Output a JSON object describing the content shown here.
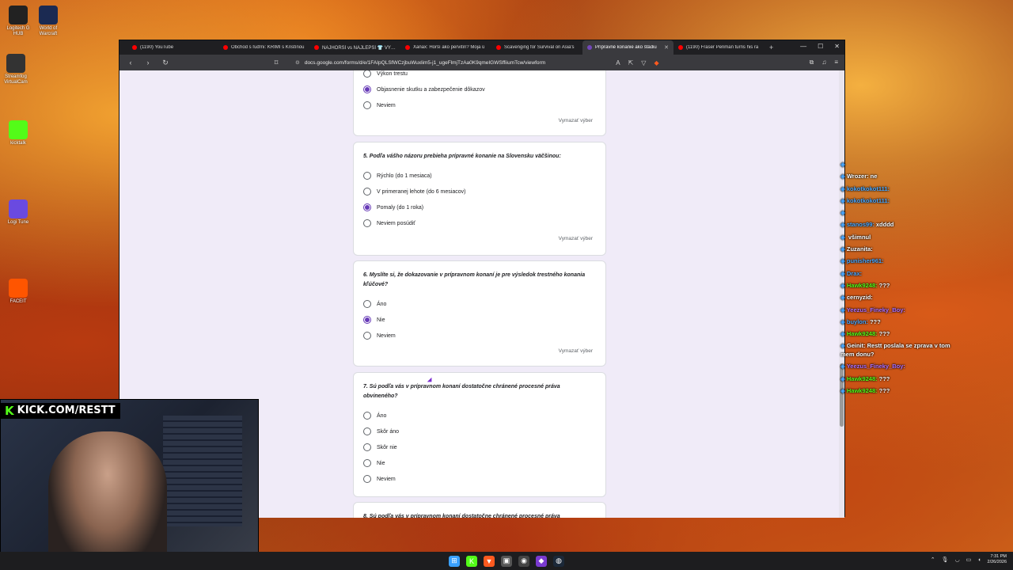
{
  "desktop_icons": [
    {
      "name": "logitech-ghub-icon",
      "label": "Logitech G HUB",
      "color": "#222"
    },
    {
      "name": "world-of-warcraft-icon",
      "label": "World of Warcraft",
      "color": "#1b2a52"
    },
    {
      "name": "streamfog-icon",
      "label": "Streamfog VirtualCam",
      "color": "#333"
    },
    {
      "name": "kicktalk-icon",
      "label": "kicktalk",
      "color": "#53fc18"
    },
    {
      "name": "logi-tune-icon",
      "label": "Logi Tune",
      "color": "#6a4ae0"
    },
    {
      "name": "faceit-icon",
      "label": "FACEIT",
      "color": "#ff5500"
    }
  ],
  "browser": {
    "tabs": [
      {
        "title": "(1190) YouTube",
        "color": "#ff0000",
        "active": false
      },
      {
        "title": "Obchod s ľuďmi: KRIMI s Kristínou",
        "color": "#ff0000",
        "active": false
      },
      {
        "title": "NAJHORŠÍ vs NAJLEPŠÍ 👕 VÝPRA",
        "color": "#ff0000",
        "active": false
      },
      {
        "title": "Xanax: Horší ako pervitín? Moja ú",
        "color": "#ff0000",
        "active": false
      },
      {
        "title": "Scavenging for Survival on Asia's ",
        "color": "#ff0000",
        "active": false
      },
      {
        "title": "Prípravné konanie ako štádiu",
        "color": "#7248b9",
        "active": true
      },
      {
        "title": "(1190) Fraser Penman turns his ra",
        "color": "#ff0000",
        "active": false
      }
    ],
    "new_tab": "+",
    "url": "docs.google.com/forms/d/e/1FAIpQLSfWCzjbuWuxlim5-j1_ugeFlmjTzAa0K9qmeIGWSffiiumTcw/viewform"
  },
  "form": {
    "clear_label": "Vymazať výber",
    "q4_partial": {
      "options": [
        {
          "label": "Výkon trestu",
          "selected": false
        },
        {
          "label": "Objasnenie skutku a zabezpečenie dôkazov",
          "selected": true
        },
        {
          "label": "Neviem",
          "selected": false
        }
      ]
    },
    "q5": {
      "title": "5. Podľa vášho názoru prebieha prípravné konanie na Slovensku väčšinou:",
      "options": [
        {
          "label": "Rýchlo (do 1 mesiaca)",
          "selected": false
        },
        {
          "label": "V primeranej lehote (do 6 mesiacov)",
          "selected": false
        },
        {
          "label": "Pomaly (do 1 roka)",
          "selected": true
        },
        {
          "label": "Neviem posúdiť",
          "selected": false
        }
      ]
    },
    "q6": {
      "title": "6. Myslíte si, že dokazovanie v prípravnom konaní je pre výsledok trestného konania kľúčové?",
      "options": [
        {
          "label": "Áno",
          "selected": false
        },
        {
          "label": "Nie",
          "selected": true
        },
        {
          "label": "Neviem",
          "selected": false
        }
      ]
    },
    "q7": {
      "title": "7. Sú podľa vás v prípravnom konaní dostatočne chránené procesné práva obvineného?",
      "options": [
        {
          "label": "Áno",
          "selected": false
        },
        {
          "label": "Skôr áno",
          "selected": false
        },
        {
          "label": "Skôr nie",
          "selected": false
        },
        {
          "label": "Nie",
          "selected": false
        },
        {
          "label": "Neviem",
          "selected": false
        }
      ]
    },
    "q8_partial_title": "8. Sú podľa vás v prípravnom konaní dostatočne chránené procesné práva"
  },
  "chat": [
    {
      "name": "",
      "text": "",
      "color": "#4aa8ff"
    },
    {
      "name": "Wrozer:",
      "text": "ne",
      "color": "#ffffff"
    },
    {
      "name": "kokotkokot111:",
      "text": "",
      "color": "#4aa8ff"
    },
    {
      "name": "kokotkokot111:",
      "text": "",
      "color": "#4aa8ff"
    },
    {
      "name": "",
      "text": "",
      "color": "#4aa8ff"
    },
    {
      "name": "stanos99:",
      "text": "xdddd",
      "color": "#4aa8ff"
    },
    {
      "name": "",
      "text": "všimnul",
      "color": "#ff5a5a"
    },
    {
      "name": "Zuzanita:",
      "text": "",
      "color": "#ffffff"
    },
    {
      "name": "punisher961:",
      "text": "",
      "color": "#4aa8ff"
    },
    {
      "name": "Drax:",
      "text": "",
      "color": "#4aa8ff"
    },
    {
      "name": "Hawk9248:",
      "text": "???",
      "color": "#53fc18"
    },
    {
      "name": "cernyzid:",
      "text": "",
      "color": "#ffffff"
    },
    {
      "name": "Yeezus_Fineky_Boy:",
      "text": "",
      "color": "#b070ff"
    },
    {
      "name": "buylon:",
      "text": "???",
      "color": "#4aa8ff"
    },
    {
      "name": "Hawk9248:",
      "text": "???",
      "color": "#53fc18"
    },
    {
      "name": "Geinit:",
      "text": "Restt poslala se zprava v tom mem donu?",
      "color": "#ffffff"
    },
    {
      "name": "Yeezus_Fineky_Boy:",
      "text": "",
      "color": "#b070ff"
    },
    {
      "name": "Hawk9248:",
      "text": "???",
      "color": "#53fc18"
    },
    {
      "name": "Hawk9248:",
      "text": "???",
      "color": "#53fc18"
    }
  ],
  "webcam": {
    "label": "KICK.COM/RESTT",
    "logo": "K"
  },
  "taskbar": {
    "apps": [
      {
        "name": "windows-start-icon",
        "glyph": "⊞",
        "color": "#3aa0ff"
      },
      {
        "name": "kick-app-icon",
        "glyph": "K",
        "color": "#53fc18"
      },
      {
        "name": "brave-browser-icon",
        "glyph": "▼",
        "color": "#ff5a1f"
      },
      {
        "name": "terminal-icon",
        "glyph": "▣",
        "color": "#555"
      },
      {
        "name": "obs-icon",
        "glyph": "◉",
        "color": "#444"
      },
      {
        "name": "app-purple-icon",
        "glyph": "◆",
        "color": "#7a3ad0"
      },
      {
        "name": "steam-icon",
        "glyph": "◍",
        "color": "#1b2838"
      }
    ],
    "time": "7:31 PM",
    "date": "2/26/2026"
  }
}
